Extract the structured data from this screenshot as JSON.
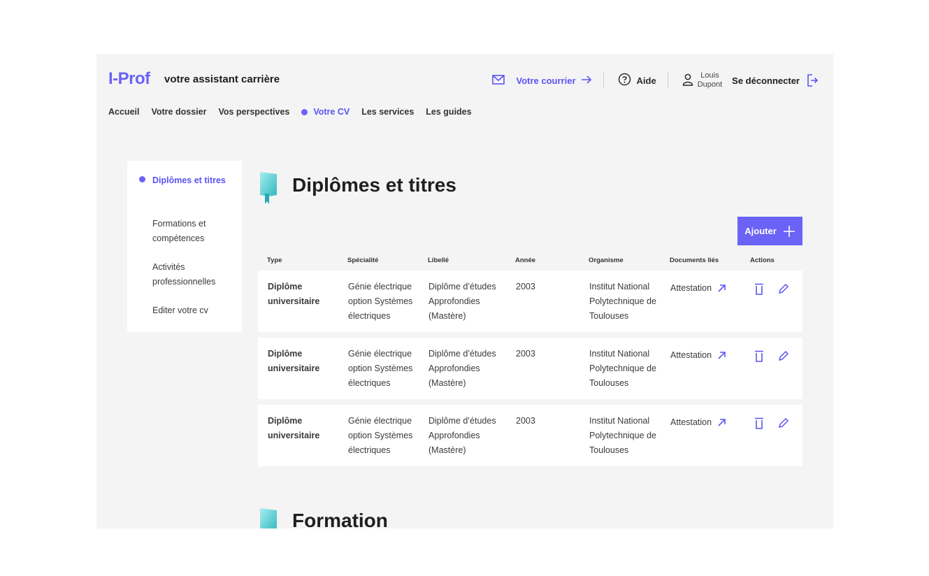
{
  "app": {
    "logo": "I-Prof",
    "tagline": "votre assistant carrière"
  },
  "header": {
    "courrier": "Votre courrier",
    "aide": "Aide",
    "user_first": "Louis",
    "user_last": "Dupont",
    "logout": "Se déconnecter"
  },
  "nav": [
    "Accueil",
    "Votre dossier",
    "Vos perspectives",
    "Votre CV",
    "Les services",
    "Les guides"
  ],
  "nav_active": "Votre CV",
  "sidebar": [
    "Diplômes et titres",
    "Formations et compétences",
    "Activités professionnelles",
    "Editer votre cv"
  ],
  "section": {
    "title": "Diplômes et titres",
    "add_label": "Ajouter"
  },
  "table": {
    "headers": [
      "Type",
      "Spécialité",
      "Libellé",
      "Année",
      "Organisme",
      "Documents liés",
      "Actions"
    ],
    "rows": [
      {
        "type": "Diplôme universitaire",
        "specialite": "Génie électrique option Systèmes électriques",
        "libelle": "Diplôme d’études Approfondies (Mastère)",
        "annee": "2003",
        "organisme": "Institut National Polytechnique de Toulouses",
        "document": "Attestation"
      },
      {
        "type": "Diplôme universitaire",
        "specialite": "Génie électrique option Systèmes électriques",
        "libelle": "Diplôme d’études Approfondies (Mastère)",
        "annee": "2003",
        "organisme": "Institut National Polytechnique de Toulouses",
        "document": "Attestation"
      },
      {
        "type": "Diplôme universitaire",
        "specialite": "Génie électrique option Systèmes électriques",
        "libelle": "Diplôme d’études Approfondies (Mastère)",
        "annee": "2003",
        "organisme": "Institut National Polytechnique de Toulouses",
        "document": "Attestation"
      }
    ]
  },
  "next_section": {
    "title": "Formation"
  },
  "colors": {
    "accent": "#6a63f6",
    "background": "#f4f4f5",
    "badge": "#3cc6c6"
  },
  "icons": [
    "mail-icon",
    "arrow-right-icon",
    "help-icon",
    "user-icon",
    "logout-icon",
    "plus-icon",
    "external-link-icon",
    "trash-icon",
    "edit-icon",
    "bookmark-badge-icon"
  ]
}
